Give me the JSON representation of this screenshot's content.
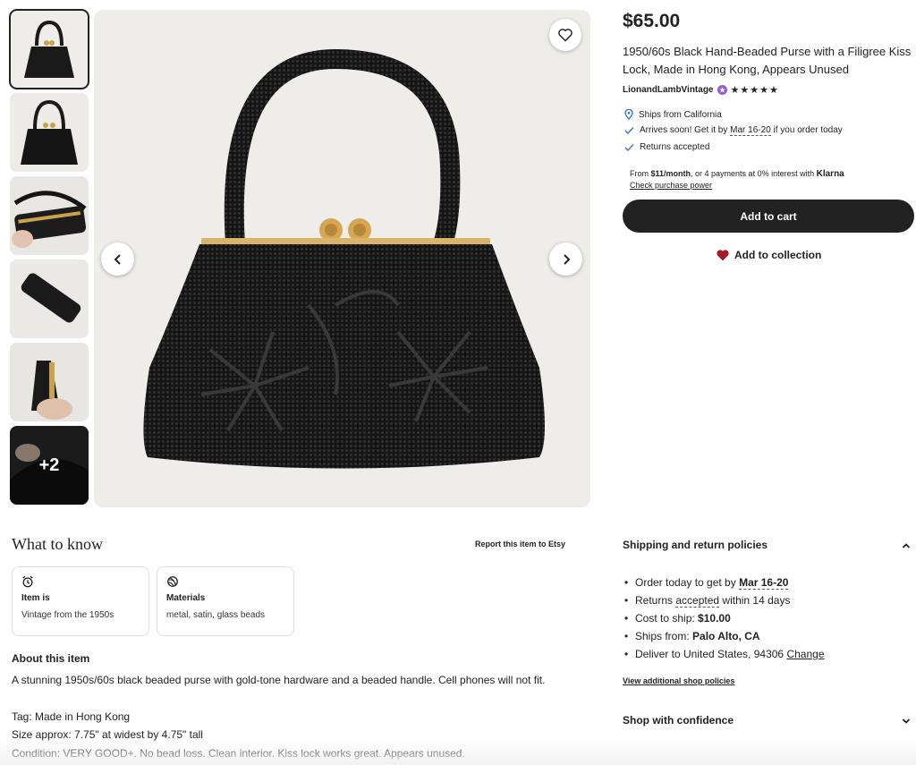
{
  "gallery": {
    "more_label": "+2"
  },
  "listing": {
    "price": "$65.00",
    "title": "1950/60s Black Hand-Beaded Purse with a Filigree Kiss Lock, Made in Hong Kong, Appears Unused",
    "seller_name": "LionandLambVintage",
    "rating_stars": "★★★★★",
    "rating_value": 5
  },
  "shipping": {
    "from": "Ships from California",
    "arrives_prefix": "Arrives soon! Get it by",
    "arrives_dates": "Mar 16-20",
    "arrives_suffix": "if you order today",
    "returns": "Returns accepted"
  },
  "klarna": {
    "prefix": "From",
    "amount": "$11/month",
    "middle": ", or 4 payments at 0% interest with",
    "brand": "Klarna",
    "link": "Check purchase power"
  },
  "actions": {
    "add_to_cart": "Add to cart",
    "add_to_collection": "Add to collection"
  },
  "what_to_know": {
    "title": "What to know",
    "report": "Report this item to Etsy",
    "cards": [
      {
        "label": "Item is",
        "value": "Vintage from the 1950s",
        "icon": "alarm-clock-icon"
      },
      {
        "label": "Materials",
        "value": "metal, satin, glass beads",
        "icon": "yarn-ball-icon"
      }
    ]
  },
  "about": {
    "heading": "About this item",
    "description": "A stunning 1950s/60s black beaded purse with gold-tone hardware and a beaded handle. Cell phones will not fit.",
    "tag": "Tag: Made in Hong Kong",
    "size": "Size approx: 7.75\" at widest by 4.75\" tall",
    "condition": "Condition: VERY GOOD+. No bead loss. Clean interior. Kiss lock works great. Appears unused."
  },
  "policies": {
    "heading": "Shipping and return policies",
    "order_prefix": "Order today to get by",
    "order_dates": "Mar 16-20",
    "returns_prefix": "Returns",
    "returns_accepted": "accepted",
    "returns_suffix": "within 14 days",
    "cost_label": "Cost to ship:",
    "cost_value": "$10.00",
    "ships_label": "Ships from:",
    "ships_value": "Palo Alto, CA",
    "deliver_text": "Deliver to United States, 94306",
    "change_link": "Change",
    "view_link": "View additional shop policies",
    "confidence": "Shop with confidence"
  },
  "colors": {
    "accent": "#222222",
    "heart": "#a61a2e",
    "seller_badge": "#9560c8",
    "location_pin": "#2f6fd6"
  }
}
